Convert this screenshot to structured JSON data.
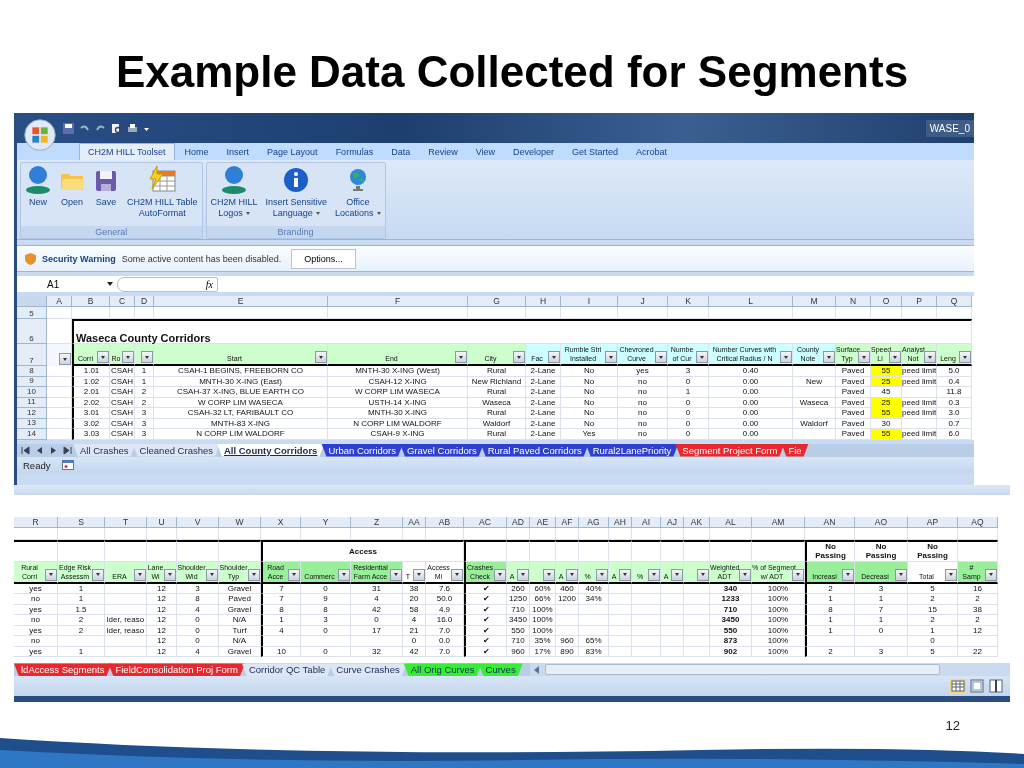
{
  "slide": {
    "title": "Example Data Collected for Segments",
    "page_number": "12"
  },
  "excel_top": {
    "title_bar": "WASE_0",
    "ribbon_tabs": [
      {
        "label": "CH2M HILL Toolset",
        "selected": true
      },
      {
        "label": "Home",
        "selected": false
      },
      {
        "label": "Insert",
        "selected": false
      },
      {
        "label": "Page Layout",
        "selected": false
      },
      {
        "label": "Formulas",
        "selected": false
      },
      {
        "label": "Data",
        "selected": false
      },
      {
        "label": "Review",
        "selected": false
      },
      {
        "label": "View",
        "selected": false
      },
      {
        "label": "Developer",
        "selected": false
      },
      {
        "label": "Get Started",
        "selected": false
      },
      {
        "label": "Acrobat",
        "selected": false
      }
    ],
    "ribbon_groups": [
      {
        "label": "General",
        "buttons": [
          {
            "label": "New",
            "kind": "person",
            "dropdown": false
          },
          {
            "label": "Open",
            "kind": "folder",
            "dropdown": false
          },
          {
            "label": "Save",
            "kind": "floppy",
            "dropdown": false
          },
          {
            "label": "CH2M HILL Table\nAutoFormat",
            "kind": "table",
            "dropdown": false
          }
        ]
      },
      {
        "label": "Branding",
        "buttons": [
          {
            "label": "CH2M HILL\nLogos",
            "kind": "person",
            "dropdown": true
          },
          {
            "label": "Insert Sensitive\nLanguage",
            "kind": "info",
            "dropdown": true
          },
          {
            "label": "Office\nLocations",
            "kind": "globe",
            "dropdown": true
          }
        ]
      }
    ],
    "security_bar": {
      "title": "Security Warning",
      "message": "Some active content has been disabled.",
      "button": "Options..."
    },
    "name_box": "A1",
    "function_label": "fx",
    "sheet": {
      "columns": [
        {
          "letter": "A",
          "color": "#f4f7fb"
        },
        {
          "letter": "B",
          "header": "Corri",
          "color": "#ccffcc"
        },
        {
          "letter": "C",
          "header": "Ro",
          "color": "#ccffcc"
        },
        {
          "letter": "D",
          "color": "#ccffcc"
        },
        {
          "letter": "E",
          "header": "Start",
          "color": "#ccffcc"
        },
        {
          "letter": "F",
          "header": "End",
          "color": "#ccffcc"
        },
        {
          "letter": "G",
          "header": "City",
          "color": "#ccffcc"
        },
        {
          "letter": "H",
          "header": "Fac",
          "color": "#ccffff"
        },
        {
          "letter": "I",
          "header": "Rumble Stri\nInstalled",
          "color": "#ccffff"
        },
        {
          "letter": "J",
          "header": "Chevroned\nCurve",
          "color": "#ccffff"
        },
        {
          "letter": "K",
          "header": "Numbe\nof Cur",
          "color": "#ccffff"
        },
        {
          "letter": "L",
          "header": "Number Curves with\nCritical Radius / N",
          "color": "#ccffff"
        },
        {
          "letter": "M",
          "header": "County\nNote",
          "color": "#ccffff"
        },
        {
          "letter": "N",
          "header": "Surface\nTyp",
          "color": "#ccffcc"
        },
        {
          "letter": "O",
          "header": "Speed\nLi",
          "color": "#ccffcc"
        },
        {
          "letter": "P",
          "header": "Analyst\nNot",
          "color": "#ccffcc"
        },
        {
          "letter": "Q",
          "header": "Leng",
          "color": "#ccffcc"
        }
      ],
      "blank_row": "5",
      "title_row": {
        "number": "6",
        "text": "Waseca County Corridors"
      },
      "header_row": "7",
      "rows": [
        {
          "number": "8",
          "cells": [
            "",
            "1.01",
            "CSAH",
            "1",
            "CSAH-1 BEGINS, FREEBORN CO",
            "MNTH-30 X-ING (West)",
            "Rural",
            "2-Lane",
            "No",
            "yes",
            "3",
            "0.40",
            "",
            "Paved",
            {
              "text": "55",
              "highlight": true
            },
            "peed limit",
            "5.0"
          ]
        },
        {
          "number": "9",
          "cells": [
            "",
            "1.02",
            "CSAH",
            "1",
            "MNTH-30 X-ING (East)",
            "CSAH-12 X-ING",
            "New Richland",
            "2-Lane",
            "No",
            "no",
            "0",
            "0.00",
            "New",
            "Paved",
            {
              "text": "25",
              "highlight": true
            },
            "peed limit",
            "0.4"
          ]
        },
        {
          "number": "10",
          "cells": [
            "",
            "2.01",
            "CSAH",
            "2",
            "CSAH-37 X-ING, BLUE EARTH CO",
            "W CORP LIM WASECA",
            "Rural",
            "2-Lane",
            "No",
            "no",
            "1",
            "0.00",
            "",
            "Paved",
            {
              "text": "45",
              "highlight": false
            },
            "",
            "11.8"
          ]
        },
        {
          "number": "11",
          "cells": [
            "",
            "2.02",
            "CSAH",
            "2",
            "W CORP LIM WASECA",
            "USTH-14 X-ING",
            "Waseca",
            "2-Lane",
            "No",
            "no",
            "0",
            "0.00",
            "Waseca",
            "Paved",
            {
              "text": "25",
              "highlight": true
            },
            "peed limit",
            "0.3"
          ]
        },
        {
          "number": "12",
          "cells": [
            "",
            "3.01",
            "CSAH",
            "3",
            "CSAH-32 LT, FARIBAULT CO",
            "MNTH-30 X-ING",
            "Rural",
            "2-Lane",
            "No",
            "no",
            "0",
            "0.00",
            "",
            "Paved",
            {
              "text": "55",
              "highlight": true
            },
            "peed limit",
            "3.0"
          ]
        },
        {
          "number": "13",
          "cells": [
            "",
            "3.02",
            "CSAH",
            "3",
            "MNTH-83 X-ING",
            "N CORP LIM WALDORF",
            "Waldorf",
            "2-Lane",
            "No",
            "no",
            "0",
            "0.00",
            "Waldorf",
            "Paved",
            {
              "text": "30",
              "highlight": false
            },
            "",
            "0.7"
          ]
        },
        {
          "number": "14",
          "cells": [
            "",
            "3.03",
            "CSAH",
            "3",
            "N CORP LIM WALDORF",
            "CSAH-9 X-ING",
            "Rural",
            "2-Lane",
            "Yes",
            "no",
            "0",
            "0.00",
            "",
            "Paved",
            {
              "text": "55",
              "highlight": true
            },
            "peed limit",
            "6.0"
          ]
        }
      ]
    },
    "sheet_tabs": [
      {
        "label": "All Crashes",
        "color": "#dce6f4",
        "selected": false
      },
      {
        "label": "Cleaned Crashes",
        "color": "#dce6f4",
        "selected": false
      },
      {
        "label": "All County Corridors",
        "selected": true
      },
      {
        "label": "Urban Corridors",
        "color": "#2f3fd0",
        "selected": false
      },
      {
        "label": "Gravel Corridors",
        "color": "#2f3fd0",
        "selected": false
      },
      {
        "label": "Rural Paved Corridors",
        "color": "#2f3fd0",
        "selected": false
      },
      {
        "label": "Rural2LanePriority",
        "color": "#2f3fd0",
        "selected": false
      },
      {
        "label": "Segment Project Form",
        "color": "#e8282e",
        "selected": false
      },
      {
        "label": "Fie",
        "color": "#e8282e",
        "selected": false
      }
    ],
    "status": "Ready"
  },
  "excel_bottom": {
    "sheet": {
      "columns": [
        {
          "letter": "R",
          "header": "Rural\nCorri",
          "color": "#ccffcc",
          "bold": false
        },
        {
          "letter": "S",
          "header": "Edge Risk\nAssessm",
          "color": "#ccffcc",
          "bold": false
        },
        {
          "letter": "T",
          "header": "ERA",
          "color": "#ccffcc",
          "bold": false
        },
        {
          "letter": "U",
          "header": "Lane\nWi",
          "color": "#ccffcc",
          "bold": false
        },
        {
          "letter": "V",
          "header": "Shoulder\nWid",
          "color": "#ccffcc",
          "bold": false
        },
        {
          "letter": "W",
          "header": "Shoulder\nTyp",
          "color": "#ccffcc",
          "bold": false
        },
        {
          "letter": "X",
          "header": "Road\nAcce",
          "color": "#99ee99",
          "bold": false
        },
        {
          "letter": "Y",
          "header": "Commerc",
          "color": "#99ee99",
          "bold": false
        },
        {
          "letter": "Z",
          "header": "Residential\nFarm Acce",
          "color": "#99ee99",
          "bold": false
        },
        {
          "letter": "AA",
          "header": "T",
          "color": "#ffffff",
          "bold": false
        },
        {
          "letter": "AB",
          "header": "Access\nMi",
          "color": "#ffffff",
          "bold": false
        },
        {
          "letter": "AC",
          "header": "Crashes\nCheck",
          "color": "#99ee99",
          "bold": false
        },
        {
          "letter": "AD",
          "header": "A",
          "color": "#ccffcc",
          "bold": false
        },
        {
          "letter": "AE",
          "color": "#ccffcc",
          "bold": false
        },
        {
          "letter": "AF",
          "header": "A",
          "color": "#ccffcc",
          "bold": false
        },
        {
          "letter": "AG",
          "header": "%",
          "color": "#ccffcc",
          "bold": false
        },
        {
          "letter": "AH",
          "header": "A",
          "color": "#ccffcc"
        },
        {
          "letter": "AI",
          "header": "%",
          "color": "#ccffcc"
        },
        {
          "letter": "AJ",
          "header": "A",
          "color": "#ccffcc"
        },
        {
          "letter": "AK",
          "color": "#ccffcc"
        },
        {
          "letter": "AL",
          "header": "Weighted\nADT",
          "color": "#ccffcc",
          "bold": true
        },
        {
          "letter": "AM",
          "header": "% of Segment\nw/ ADT",
          "color": "#ccffcc",
          "bold": false
        },
        {
          "letter": "AN",
          "header": "Increasi",
          "color": "#99ee99",
          "bold": false
        },
        {
          "letter": "AO",
          "header": "Decreasi",
          "color": "#99ee99",
          "bold": false
        },
        {
          "letter": "AP",
          "header": "Total",
          "color": "#ffffff",
          "bold": false
        },
        {
          "letter": "AQ",
          "header": "#\nSamp",
          "color": "#99ee99",
          "bold": false
        }
      ],
      "groups": [
        {
          "label": "Access"
        },
        {
          "label": "No\nPassing"
        },
        {
          "label": "No\nPassing"
        },
        {
          "label": "No\nPassing"
        }
      ],
      "rows": [
        {
          "cells": [
            "yes",
            "1",
            "",
            "12",
            "3",
            "Gravel",
            "7",
            "0",
            "31",
            "38",
            "7.6",
            "✔",
            "260",
            "60%",
            "460",
            "40%",
            "",
            "",
            "",
            "",
            "340",
            "100%",
            "2",
            "3",
            "5",
            "16"
          ]
        },
        {
          "cells": [
            "no",
            "1",
            "",
            "12",
            "8",
            "Paved",
            "7",
            "9",
            "4",
            "20",
            "50.0",
            "✔",
            "1250",
            "66%",
            "1200",
            "34%",
            "",
            "",
            "",
            "",
            "1233",
            "100%",
            "1",
            "1",
            "2",
            "2"
          ]
        },
        {
          "cells": [
            "yes",
            "1.5",
            "",
            "12",
            "4",
            "Gravel",
            "8",
            "8",
            "42",
            "58",
            "4.9",
            "✔",
            "710",
            "100%",
            "",
            "",
            "",
            "",
            "",
            "",
            "710",
            "100%",
            "8",
            "7",
            "15",
            "38"
          ]
        },
        {
          "cells": [
            "no",
            "2",
            "lder, reaso",
            "12",
            "0",
            "N/A",
            "1",
            "3",
            "0",
            "4",
            "16.0",
            "✔",
            "3450",
            "100%",
            "",
            "",
            "",
            "",
            "",
            "",
            "3450",
            "100%",
            "1",
            "1",
            "2",
            "2"
          ]
        },
        {
          "cells": [
            "yes",
            "2",
            "lder, reaso",
            "12",
            "0",
            "Turf",
            "4",
            "0",
            "17",
            "21",
            "7.0",
            "✔",
            "550",
            "100%",
            "",
            "",
            "",
            "",
            "",
            "",
            "550",
            "100%",
            "1",
            "0",
            "1",
            "12"
          ]
        },
        {
          "cells": [
            "no",
            "",
            "",
            "12",
            "0",
            "N/A",
            "",
            "",
            "",
            "0",
            "0.0",
            "✔",
            "710",
            "35%",
            "960",
            "65%",
            "",
            "",
            "",
            "",
            "873",
            "100%",
            "",
            "",
            "0",
            ""
          ]
        },
        {
          "cells": [
            "yes",
            "1",
            "",
            "12",
            "4",
            "Gravel",
            "10",
            "0",
            "32",
            "42",
            "7.0",
            "✔",
            "960",
            "17%",
            "890",
            "83%",
            "",
            "",
            "",
            "",
            "902",
            "100%",
            "2",
            "3",
            "5",
            "22"
          ]
        }
      ]
    },
    "sheet_tabs": [
      {
        "label": "ldAccess Segments",
        "color": "#e8282e",
        "selected": false
      },
      {
        "label": "FieldConsolidation Proj Form",
        "color": "#e8282e",
        "selected": false
      },
      {
        "label": "Corridor QC Table",
        "color": "#dce6f4",
        "selected": false
      },
      {
        "label": "Curve Crashes",
        "color": "#dce6f4",
        "selected": false
      },
      {
        "label": "All Orig Curves",
        "color": "#33ee33",
        "selected": false
      },
      {
        "label": "Curves",
        "color": "#33ee33",
        "selected": false
      }
    ]
  }
}
